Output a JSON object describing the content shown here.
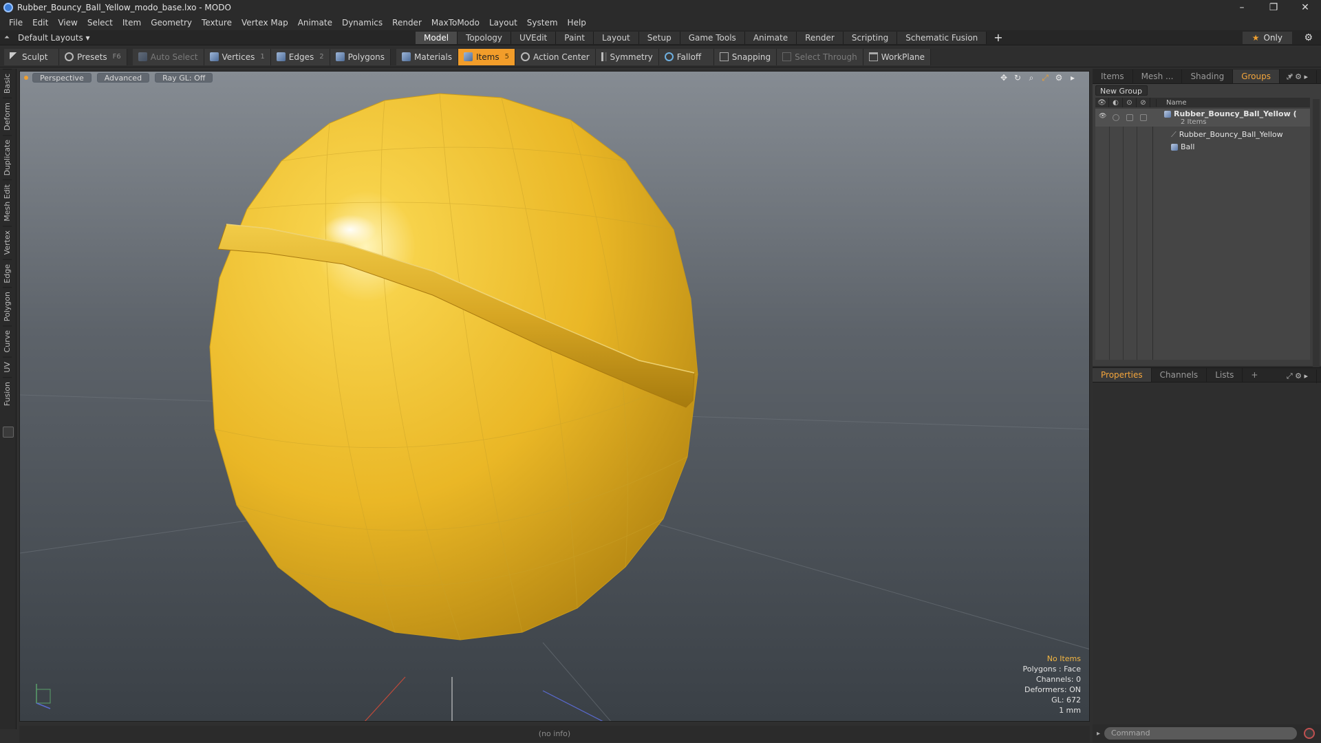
{
  "window": {
    "title": "Rubber_Bouncy_Ball_Yellow_modo_base.lxo - MODO",
    "controls": [
      "–",
      "❐",
      "✕"
    ]
  },
  "menu": [
    "File",
    "Edit",
    "View",
    "Select",
    "Item",
    "Geometry",
    "Texture",
    "Vertex Map",
    "Animate",
    "Dynamics",
    "Render",
    "MaxToModo",
    "Layout",
    "System",
    "Help"
  ],
  "layout": {
    "default_label": "Default Layouts ▾",
    "tabs": [
      "Model",
      "Topology",
      "UVEdit",
      "Paint",
      "Layout",
      "Setup",
      "Game Tools",
      "Animate",
      "Render",
      "Scripting",
      "Schematic Fusion"
    ],
    "active_tab": "Model",
    "plus": "+",
    "only_label": "Only"
  },
  "toolbar": {
    "sculpt": "Sculpt",
    "presets": "Presets",
    "presets_key": "F6",
    "auto_select": "Auto Select",
    "vertices": "Vertices",
    "vertices_key": "1",
    "edges": "Edges",
    "edges_key": "2",
    "polygons": "Polygons",
    "materials": "Materials",
    "items": "Items",
    "items_key": "5",
    "action_center": "Action Center",
    "symmetry": "Symmetry",
    "falloff": "Falloff",
    "snapping": "Snapping",
    "select_through": "Select Through",
    "workplane": "WorkPlane"
  },
  "left_tabs": [
    "Basic",
    "Deform",
    "Duplicate",
    "Mesh Edit",
    "Vertex",
    "Edge",
    "Polygon",
    "Curve",
    "UV",
    "Fusion"
  ],
  "viewport": {
    "view": "Perspective",
    "mode": "Advanced",
    "raygl": "Ray GL: Off",
    "stats": {
      "selection": "No Items",
      "polygons": "Polygons : Face",
      "channels": "Channels: 0",
      "deformers": "Deformers: ON",
      "gl": "GL: 672",
      "unit": "1 mm"
    }
  },
  "status": "(no info)",
  "colors": {
    "accent": "#f29d2a",
    "ball": "#f2c12a",
    "ball_shadow": "#b9850e"
  },
  "panel": {
    "tabs": [
      "Items",
      "Mesh ...",
      "Shading",
      "Groups"
    ],
    "active_tab": "Groups",
    "new_group": "New Group",
    "name_col": "Name",
    "group": {
      "name": "Rubber_Bouncy_Ball_Yellow",
      "count": "2 Items",
      "children": [
        "Rubber_Bouncy_Ball_Yellow",
        "Ball"
      ]
    },
    "prop_tabs": [
      "Properties",
      "Channels",
      "Lists"
    ],
    "prop_active": "Properties",
    "prop_plus": "+",
    "command_placeholder": "Command"
  }
}
